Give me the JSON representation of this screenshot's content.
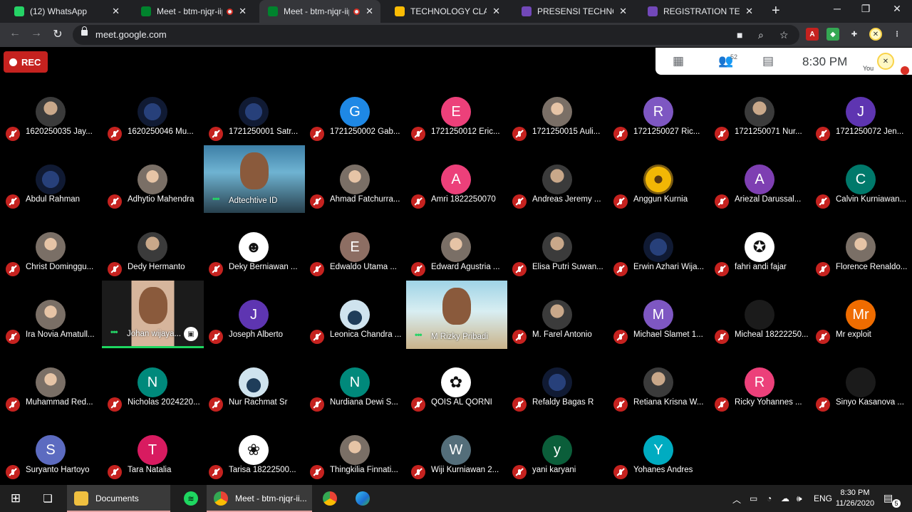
{
  "browser": {
    "tabs": [
      {
        "title": "(12) WhatsApp",
        "icon": "whatsapp-icon",
        "color": "#25d366",
        "recording": false,
        "active": false
      },
      {
        "title": "Meet - btm-njqr-iip",
        "icon": "google-meet-icon",
        "color": "#00832d",
        "recording": true,
        "active": false
      },
      {
        "title": "Meet - btm-njqr-iip",
        "icon": "google-meet-icon",
        "color": "#00832d",
        "recording": true,
        "active": true
      },
      {
        "title": "TECHNOLOGY CLASS I",
        "icon": "google-drive-icon",
        "color": "#fbbc04",
        "recording": false,
        "active": false
      },
      {
        "title": "PRESENSI TECHNOLOG",
        "icon": "google-forms-icon",
        "color": "#7248b9",
        "recording": false,
        "active": false
      },
      {
        "title": "REGISTRATION TECHNO",
        "icon": "google-forms-icon",
        "color": "#7248b9",
        "recording": false,
        "active": false
      }
    ],
    "url": "meet.google.com"
  },
  "meet": {
    "rec_label": "REC",
    "participant_count": "52",
    "time": "8:30 PM",
    "you_label": "You"
  },
  "participants": [
    {
      "name": "1620250035 Jay...",
      "avatar": "photo"
    },
    {
      "name": "1620250046 Mu...",
      "avatar": "photo3"
    },
    {
      "name": "1721250001 Satr...",
      "avatar": "photo3"
    },
    {
      "name": "1721250002 Gab...",
      "avatar": "letter",
      "letter": "G",
      "color": "#1e88e5"
    },
    {
      "name": "1721250012 Eric...",
      "avatar": "letter",
      "letter": "E",
      "color": "#ec407a"
    },
    {
      "name": "1721250015 Auli...",
      "avatar": "photo2"
    },
    {
      "name": "1721250027 Ric...",
      "avatar": "letter",
      "letter": "R",
      "color": "#7e57c2"
    },
    {
      "name": "1721250071 Nur...",
      "avatar": "photo"
    },
    {
      "name": "1721250072 Jen...",
      "avatar": "letter",
      "letter": "J",
      "color": "#5e35b1"
    },
    {
      "name": "Abdul Rahman",
      "avatar": "photo3"
    },
    {
      "name": "Adhytio Mahendra",
      "avatar": "photo2"
    },
    {
      "name": "Adtechtive ID",
      "avatar": "video"
    },
    {
      "name": "Ahmad Fatchurra...",
      "avatar": "photo2"
    },
    {
      "name": "Amri 1822250070",
      "avatar": "letter",
      "letter": "A",
      "color": "#ec407a"
    },
    {
      "name": "Andreas Jeremy ...",
      "avatar": "photo"
    },
    {
      "name": "Anggun Kurnia",
      "avatar": "flower"
    },
    {
      "name": "Ariezal Darussal...",
      "avatar": "letter",
      "letter": "A",
      "color": "#7e3fb2"
    },
    {
      "name": "Calvin Kurniawan...",
      "avatar": "letter",
      "letter": "C",
      "color": "#00796b"
    },
    {
      "name": "Christ Dominggu...",
      "avatar": "photo2"
    },
    {
      "name": "Dedy Hermanto",
      "avatar": "photo"
    },
    {
      "name": "Deky Berniawan ...",
      "avatar": "emoji",
      "glyph": "☻"
    },
    {
      "name": "Edwaldo Utama ...",
      "avatar": "letter",
      "letter": "E",
      "color": "#8d6e63"
    },
    {
      "name": "Edward Agustria ...",
      "avatar": "photo2"
    },
    {
      "name": "Elisa Putri Suwan...",
      "avatar": "photo"
    },
    {
      "name": "Erwin Azhari Wija...",
      "avatar": "photo3"
    },
    {
      "name": "fahri andi fajar",
      "avatar": "emoji",
      "glyph": "✪"
    },
    {
      "name": "Florence Renaldo...",
      "avatar": "photo2"
    },
    {
      "name": "Ira Novia Amatull...",
      "avatar": "photo2"
    },
    {
      "name": "Johan wijaya...",
      "avatar": "video"
    },
    {
      "name": "Joseph Alberto",
      "avatar": "letter",
      "letter": "J",
      "color": "#5e35b1"
    },
    {
      "name": "Leonica Chandra ...",
      "avatar": "sky"
    },
    {
      "name": "M Rizky Pribadi",
      "avatar": "video"
    },
    {
      "name": "M. Farel Antonio",
      "avatar": "photo"
    },
    {
      "name": "Michael Slamet 1...",
      "avatar": "letter",
      "letter": "M",
      "color": "#7e57c2"
    },
    {
      "name": "Micheal 18222250...",
      "avatar": "dark"
    },
    {
      "name": "Mr exploit",
      "avatar": "letter",
      "letter": "Mr",
      "color": "#ef6c00"
    },
    {
      "name": "Muhammad Red...",
      "avatar": "photo2"
    },
    {
      "name": "Nicholas 2024220...",
      "avatar": "letter",
      "letter": "N",
      "color": "#00897b"
    },
    {
      "name": "Nur Rachmat Sr",
      "avatar": "sky"
    },
    {
      "name": "Nurdiana Dewi S...",
      "avatar": "letter",
      "letter": "N",
      "color": "#00897b"
    },
    {
      "name": "QOIS AL QORNI",
      "avatar": "emoji",
      "glyph": "✿"
    },
    {
      "name": "Refaldy Bagas R",
      "avatar": "photo3"
    },
    {
      "name": "Retiana Krisna W...",
      "avatar": "photo"
    },
    {
      "name": "Ricky Yohannes ...",
      "avatar": "letter",
      "letter": "R",
      "color": "#ec407a"
    },
    {
      "name": "Sinyo Kasanova ...",
      "avatar": "dark"
    },
    {
      "name": "Suryanto Hartoyo",
      "avatar": "letter",
      "letter": "S",
      "color": "#5c6bc0"
    },
    {
      "name": "Tara Natalia",
      "avatar": "letter",
      "letter": "T",
      "color": "#d81b60"
    },
    {
      "name": "Tarisa 18222500...",
      "avatar": "emoji",
      "glyph": "❀"
    },
    {
      "name": "Thingkilia Finnati...",
      "avatar": "photo2"
    },
    {
      "name": "Wiji Kurniawan 2...",
      "avatar": "letter",
      "letter": "W",
      "color": "#546e7a"
    },
    {
      "name": "yani karyani",
      "avatar": "letter",
      "letter": "y",
      "color": "#0b5e3a"
    },
    {
      "name": "Yohanes Andres",
      "avatar": "letter",
      "letter": "Y",
      "color": "#00acc1"
    }
  ],
  "taskbar": {
    "items": [
      {
        "label": "Documents",
        "icon": "folder-icon"
      },
      {
        "label": "Meet - btm-njqr-ii...",
        "icon": "chrome-icon"
      }
    ],
    "language": "ENG",
    "clock_time": "8:30 PM",
    "clock_date": "11/26/2020",
    "notifications": "5"
  }
}
